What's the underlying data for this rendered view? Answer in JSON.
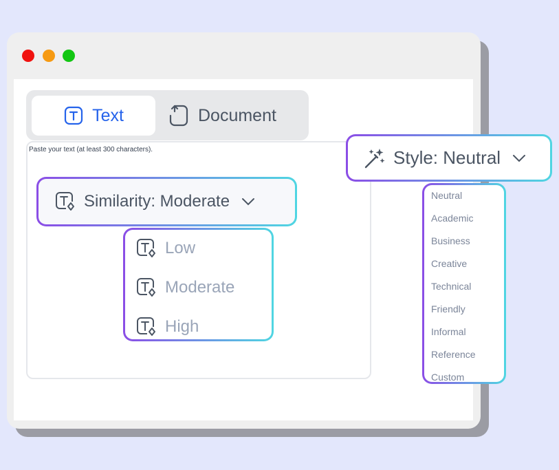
{
  "window": {
    "controls": [
      "close",
      "minimize",
      "maximize"
    ]
  },
  "tabs": [
    {
      "label": "Text",
      "icon": "text-icon",
      "active": true,
      "color": "#2563eb"
    },
    {
      "label": "Document",
      "icon": "document-icon",
      "active": false
    }
  ],
  "editor": {
    "placeholder": "Paste your text (at least 300 characters)."
  },
  "similarity": {
    "label": "Similarity: Moderate",
    "options": [
      "Low",
      "Moderate",
      "High"
    ]
  },
  "style": {
    "label": "Style: Neutral",
    "options": [
      "Neutral",
      "Academic",
      "Business",
      "Creative",
      "Technical",
      "Friendly",
      "Informal",
      "Reference",
      "Custom"
    ]
  },
  "colors": {
    "background": "#e3e7fc",
    "gradient_start": "#8b4de6",
    "gradient_end": "#4fd6e2"
  }
}
